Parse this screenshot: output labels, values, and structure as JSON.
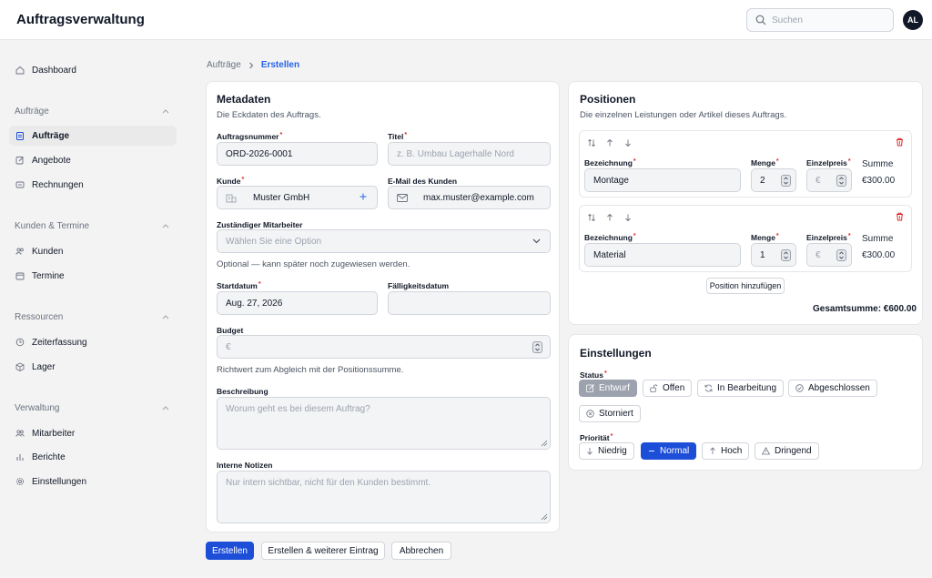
{
  "app": {
    "title": "Auftragsverwaltung",
    "user_initials": "AL"
  },
  "search": {
    "placeholder": "Suchen"
  },
  "sidebar": {
    "dashboard": "Dashboard",
    "groups": [
      {
        "label": "Aufträge",
        "items": [
          "Aufträge",
          "Angebote",
          "Rechnungen"
        ]
      },
      {
        "label": "Kunden & Termine",
        "items": [
          "Kunden",
          "Termine"
        ]
      },
      {
        "label": "Ressourcen",
        "items": [
          "Zeiterfassung",
          "Lager"
        ]
      },
      {
        "label": "Verwaltung",
        "items": [
          "Mitarbeiter",
          "Berichte",
          "Einstellungen"
        ]
      }
    ]
  },
  "breadcrumb": {
    "parent": "Aufträge",
    "current": "Erstellen"
  },
  "metadata": {
    "title": "Metadaten",
    "description": "Die Eckdaten des Auftrags.",
    "order_number_label": "Auftragsnummer",
    "order_number_value": "ORD-2026-0001",
    "title_label": "Titel",
    "title_placeholder": "z. B. Umbau Lagerhalle Nord",
    "customer_label": "Kunde",
    "customer_value": "Muster GmbH",
    "email_label": "E-Mail des Kunden",
    "email_value": "max.muster@example.com",
    "employee_label": "Zuständiger Mitarbeiter",
    "employee_placeholder": "Wählen Sie eine Option",
    "employee_hint": "Optional — kann später noch zugewiesen werden.",
    "start_label": "Startdatum",
    "start_value": "Aug. 27, 2026",
    "due_label": "Fälligkeitsdatum",
    "budget_label": "Budget",
    "budget_prefix": "€",
    "budget_hint": "Richtwert zum Abgleich mit der Positionssumme.",
    "description_label": "Beschreibung",
    "description_placeholder": "Worum geht es bei diesem Auftrag?",
    "notes_label": "Interne Notizen",
    "notes_placeholder": "Nur intern sichtbar, nicht für den Kunden bestimmt."
  },
  "positions": {
    "title": "Positionen",
    "description": "Die einzelnen Leistungen oder Artikel dieses Auftrags.",
    "col_name": "Bezeichnung",
    "col_qty": "Menge",
    "col_price": "Einzelpreis",
    "col_sum": "Summe",
    "currency": "€",
    "rows": [
      {
        "name": "Montage",
        "qty": "2",
        "sum": "€300.00"
      },
      {
        "name": "Material",
        "qty": "1",
        "sum": "€300.00"
      }
    ],
    "add_label": "Position hinzufügen",
    "total": "Gesamtsumme: €600.00"
  },
  "settings": {
    "title": "Einstellungen",
    "status_label": "Status",
    "status_options": [
      "Entwurf",
      "Offen",
      "In Bearbeitung",
      "Abgeschlossen",
      "Storniert"
    ],
    "priority_label": "Priorität",
    "priority_options": [
      "Niedrig",
      "Normal",
      "Hoch",
      "Dringend"
    ]
  },
  "actions": {
    "create": "Erstellen",
    "create_another": "Erstellen & weiterer Eintrag",
    "cancel": "Abbrechen"
  },
  "colors": {
    "primary": "#1d4ed8",
    "danger": "#dc2626",
    "selected_status": "#9ca3af"
  }
}
